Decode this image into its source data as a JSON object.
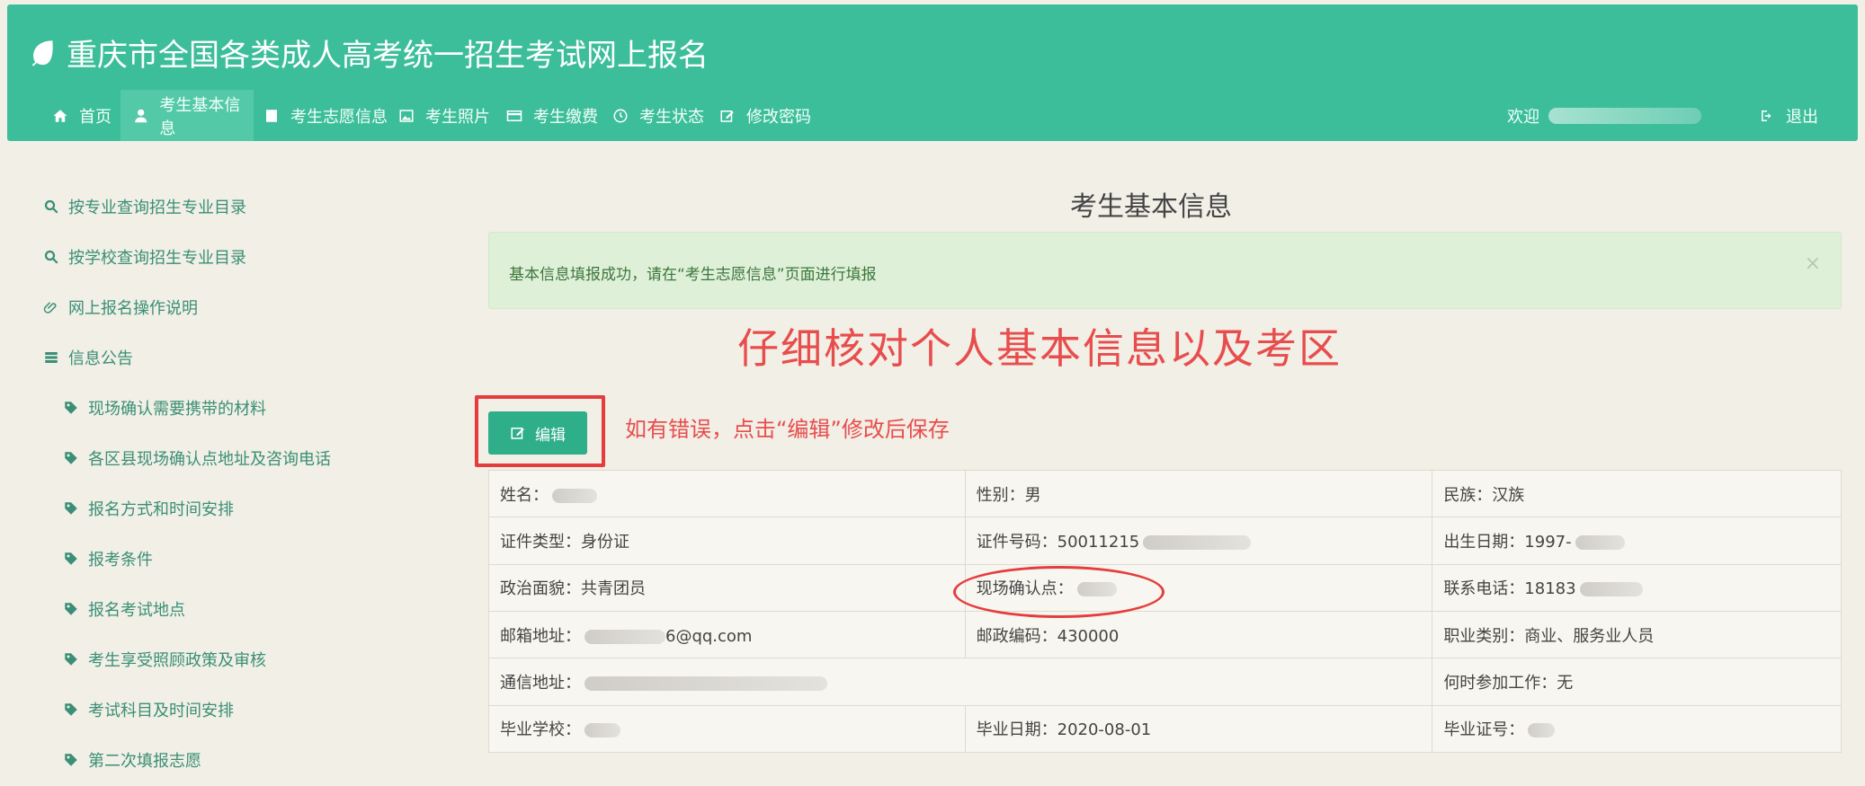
{
  "header": {
    "title": "重庆市全国各类成人高考统一招生考试网上报名",
    "nav": [
      {
        "label": "首页",
        "icon": "home-icon"
      },
      {
        "label": "考生基本信息",
        "icon": "user-icon",
        "active": true
      },
      {
        "label": "考生志愿信息",
        "icon": "book-icon"
      },
      {
        "label": "考生照片",
        "icon": "image-icon"
      },
      {
        "label": "考生缴费",
        "icon": "card-icon"
      },
      {
        "label": "考生状态",
        "icon": "clock-icon"
      },
      {
        "label": "修改密码",
        "icon": "edit-icon"
      }
    ],
    "welcome_label": "欢迎",
    "logout_label": "退出"
  },
  "sidebar": {
    "items": [
      {
        "label": "按专业查询招生专业目录",
        "icon": "search-icon"
      },
      {
        "label": "按学校查询招生专业目录",
        "icon": "search-icon"
      },
      {
        "label": "网上报名操作说明",
        "icon": "paperclip-icon"
      },
      {
        "label": "信息公告",
        "icon": "list-icon"
      },
      {
        "label": "现场确认需要携带的材料",
        "icon": "tag-icon"
      },
      {
        "label": "各区县现场确认点地址及咨询电话",
        "icon": "tag-icon"
      },
      {
        "label": "报名方式和时间安排",
        "icon": "tag-icon"
      },
      {
        "label": "报考条件",
        "icon": "tag-icon"
      },
      {
        "label": "报名考试地点",
        "icon": "tag-icon"
      },
      {
        "label": "考生享受照顾政策及审核",
        "icon": "tag-icon"
      },
      {
        "label": "考试科目及时间安排",
        "icon": "tag-icon"
      },
      {
        "label": "第二次填报志愿",
        "icon": "tag-icon"
      }
    ]
  },
  "main": {
    "title": "考生基本信息",
    "alert_text": "基本信息填报成功，请在“考生志愿信息”页面进行填报",
    "alert_close": "×",
    "annotation_title": "仔细核对个人基本信息以及考区",
    "edit_label": "编辑",
    "annotation_hint": "如有错误，点击“编辑”修改后保存"
  },
  "info": {
    "name_label": "姓名：",
    "gender": "性别：男",
    "ethnicity": "民族：汉族",
    "id_type": "证件类型：身份证",
    "id_number": "证件号码：50011215",
    "birth_date": "出生日期：1997-",
    "political": "政治面貌：共青团员",
    "confirm_point_label": "现场确认点：",
    "phone": "联系电话：18183",
    "email": "6@qq.com",
    "email_label": "邮箱地址：",
    "postcode": "邮政编码：430000",
    "occupation": "职业类别：商业、服务业人员",
    "address_label": "通信地址：",
    "work_start": "何时参加工作：无",
    "school_label": "毕业学校：",
    "grad_date": "毕业日期：2020-08-01",
    "cert_label": "毕业证号："
  },
  "colors": {
    "header": "#3dbe9a",
    "accent": "#2fae8a",
    "annotation": "#e53d3d"
  }
}
